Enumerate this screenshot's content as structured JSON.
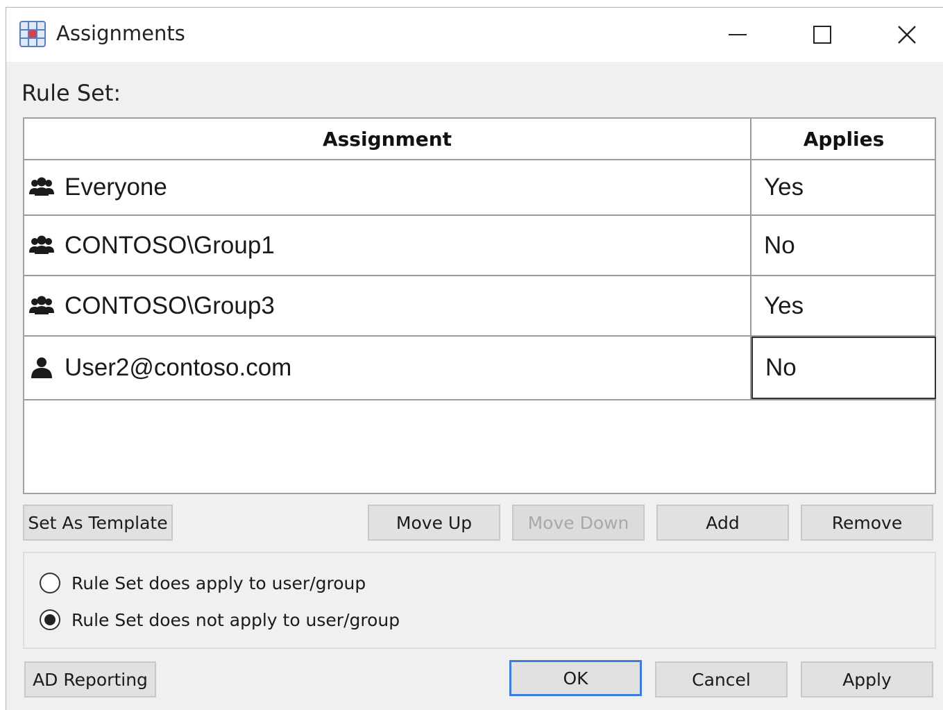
{
  "window": {
    "title": "Assignments",
    "app_icon": "grid-icon"
  },
  "window_controls": {
    "minimize": "minimize-icon",
    "maximize": "maximize-icon",
    "close": "close-icon"
  },
  "rule_set_label": "Rule Set:",
  "table": {
    "columns": [
      "Assignment",
      "Applies"
    ],
    "rows": [
      {
        "icon": "group-icon",
        "name": "Everyone",
        "applies": "Yes"
      },
      {
        "icon": "group-icon",
        "name": "CONTOSO\\Group1",
        "applies": "No"
      },
      {
        "icon": "group-icon",
        "name": "CONTOSO\\Group3",
        "applies": "Yes"
      },
      {
        "icon": "user-icon",
        "name": "User2@contoso.com",
        "applies": "No",
        "selected": true
      }
    ]
  },
  "buttons": {
    "set_as_template": "Set As Template",
    "move_up": "Move Up",
    "move_down": "Move Down",
    "add": "Add",
    "remove": "Remove",
    "ad_reporting": "AD Reporting",
    "ok": "OK",
    "cancel": "Cancel",
    "apply": "Apply"
  },
  "radio_options": [
    {
      "label": "Rule Set does apply to user/group",
      "checked": false
    },
    {
      "label": "Rule Set does not apply to user/group",
      "checked": true
    }
  ]
}
